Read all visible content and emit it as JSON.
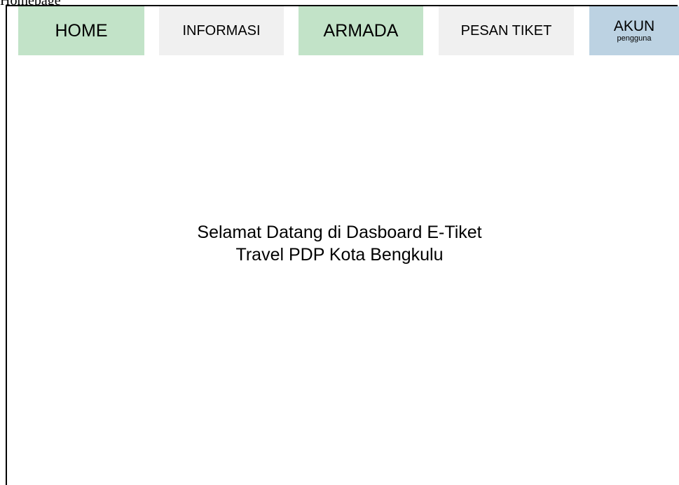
{
  "header": {
    "top_label": "Homepage"
  },
  "nav": {
    "home": "HOME",
    "informasi": "INFORMASI",
    "armada": "ARMADA",
    "pesan_tiket": "PESAN TIKET",
    "akun": "AKUN",
    "akun_sub": "pengguna"
  },
  "main": {
    "welcome_line1": "Selamat Datang di Dasboard E-Tiket",
    "welcome_line2": "Travel PDP Kota Bengkulu"
  },
  "colors": {
    "home_bg": "#c2e3c8",
    "informasi_bg": "#f0f0f0",
    "armada_bg": "#c2e3c8",
    "pesan_tiket_bg": "#f0f0f0",
    "akun_bg": "#bcd2e2"
  }
}
